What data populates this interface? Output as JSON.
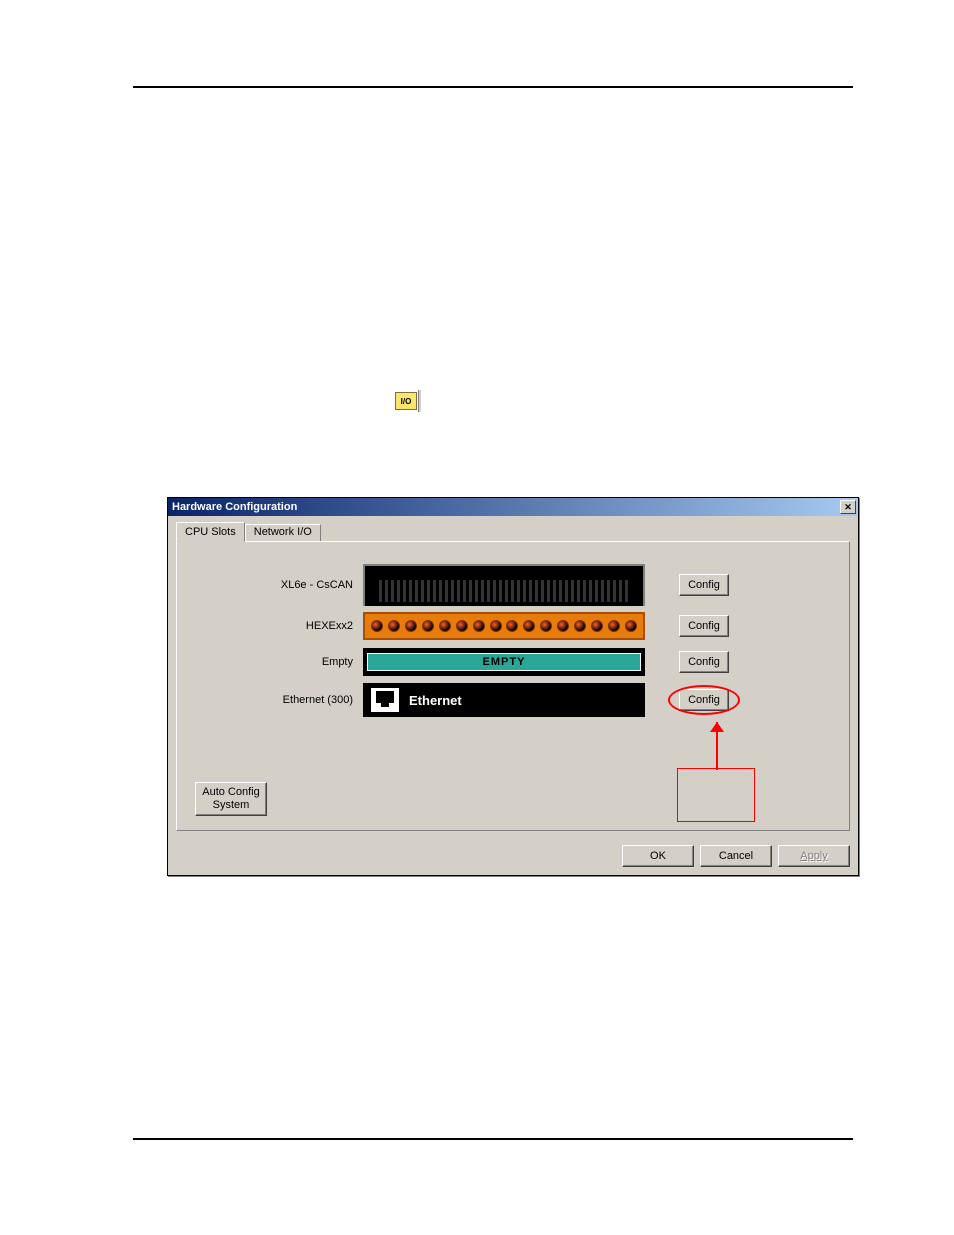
{
  "toolbar_icon": "I/O",
  "dialog": {
    "title": "Hardware Configuration",
    "tabs": {
      "cpu": "CPU Slots",
      "network": "Network I/O"
    },
    "slots": {
      "row0": {
        "label": "XL6e - CsCAN",
        "config": "Config"
      },
      "row1": {
        "label": "HEXExx2",
        "config": "Config"
      },
      "row2": {
        "label": "Empty",
        "graphic": "EMPTY",
        "config": "Config"
      },
      "row3": {
        "label": "Ethernet (300)",
        "graphic": "Ethernet",
        "config": "Config"
      }
    },
    "auto_config": "Auto Config System",
    "footer": {
      "ok": "OK",
      "cancel": "Cancel",
      "apply": "Apply"
    }
  }
}
